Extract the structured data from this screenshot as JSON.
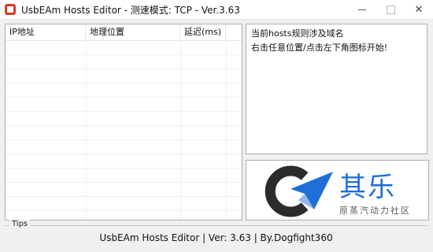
{
  "window": {
    "title": "UsbEAm Hosts Editor - 测速模式: TCP - Ver.3.63",
    "minimize_label": "—",
    "close_label": "✕"
  },
  "list": {
    "columns": [
      "IP地址",
      "地理位置",
      "延迟(ms)"
    ]
  },
  "info": {
    "lines": [
      "当前hosts规则涉及域名",
      "右击任意位置/点击左下角图标开始!"
    ]
  },
  "logo": {
    "text_main": "其乐",
    "text_sub": "原蒸汽动力社区"
  },
  "tips": {
    "label": "Tips",
    "status": "UsbEAm Hosts Editor | Ver: 3.63 | By.Dogfight360"
  },
  "colors": {
    "accent": "#1f6fd6",
    "icon_red": "#d93a2b",
    "logo_dark": "#2b2b2b"
  }
}
